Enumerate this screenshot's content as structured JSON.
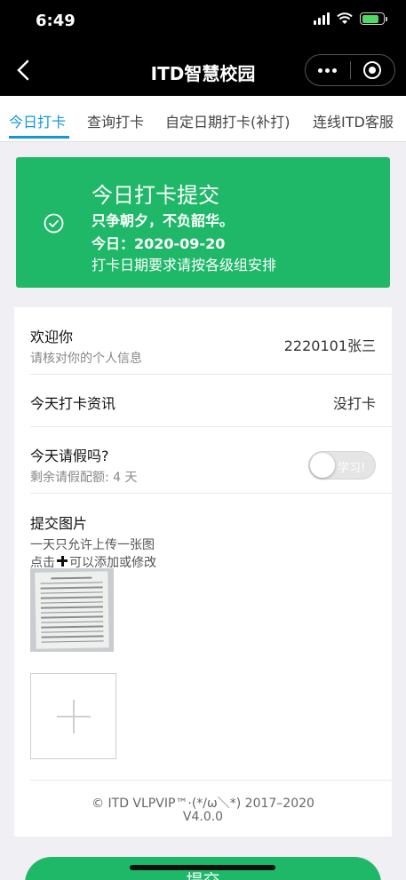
{
  "status_bar": {
    "time": "6:49",
    "icons": [
      "signal-icon",
      "wifi-icon",
      "battery-charging-icon"
    ],
    "battery_level": 0.8
  },
  "navbar": {
    "title": "ITD智慧校园",
    "back_icon": "chevron-left-icon",
    "menu_icon": "more-dots-icon",
    "close_icon": "target-icon"
  },
  "tabs": [
    {
      "label": "今日打卡",
      "active": true
    },
    {
      "label": "查询打卡",
      "active": false
    },
    {
      "label": "自定日期打卡(补打)",
      "active": false
    },
    {
      "label": "连线ITD客服",
      "active": false
    }
  ],
  "banner": {
    "icon": "check-circle-icon",
    "title": "今日打卡提交",
    "motto": "只争朝夕，不负韶华。",
    "today": "今日：2020-09-20",
    "note": "打卡日期要求请按各级组安排",
    "color": "#1eb868"
  },
  "info": {
    "welcome_label": "欢迎你",
    "welcome_sub": "请核对你的个人信息",
    "user_value": "2220101张三",
    "checkin_label": "今天打卡资讯",
    "checkin_value": "没打卡",
    "leave_label": "今天请假吗?",
    "leave_sub": "剩余请假配额: 4 天",
    "leave_toggle_text": "学习!",
    "leave_toggle_on": false
  },
  "upload": {
    "title": "提交图片",
    "hint1": "一天只允许上传一张图",
    "hint2_before": "点击",
    "hint2_after": "可以添加或修改",
    "add_icon": "plus-icon"
  },
  "footer": {
    "copyright": "© ITD VLPVIP™·(*/ω＼*) 2017–2020",
    "version": "V4.0.0"
  },
  "submit_label": "提交",
  "accent_color": "#1296db"
}
